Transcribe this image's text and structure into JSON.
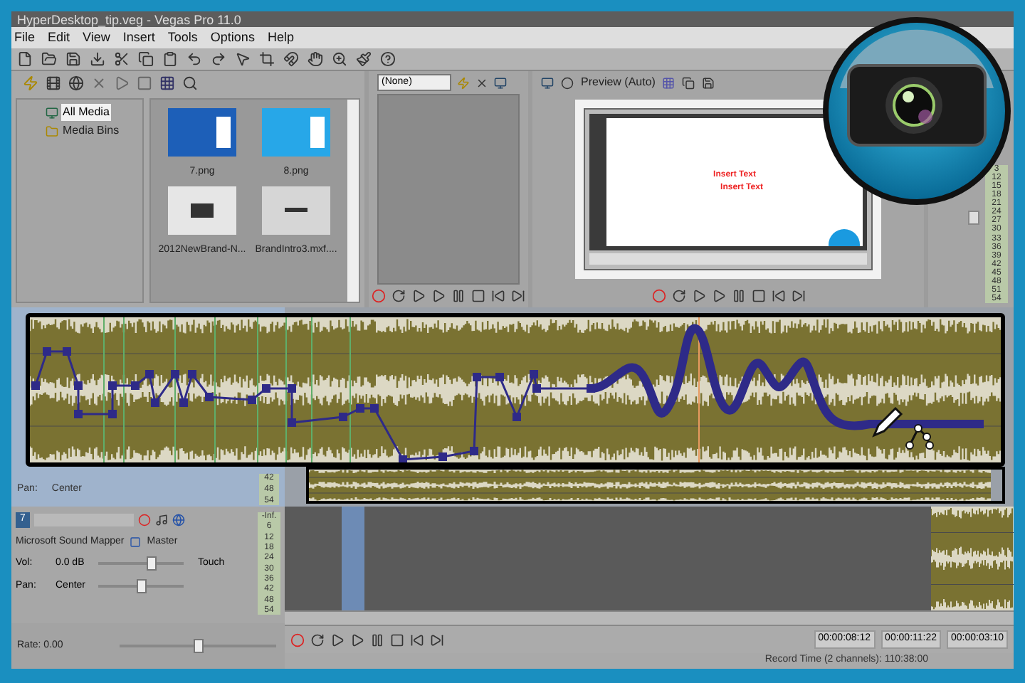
{
  "window": {
    "title": "HyperDesktop_tip.veg - Vegas Pro 11.0"
  },
  "menu": [
    "File",
    "Edit",
    "View",
    "Insert",
    "Tools",
    "Options",
    "Help"
  ],
  "explorer": {
    "tree": [
      {
        "label": "All Media",
        "selected": true
      },
      {
        "label": "Media Bins",
        "selected": false
      }
    ],
    "files": [
      {
        "name": "7.png",
        "kind": "desktop"
      },
      {
        "name": "8.png",
        "kind": "tile"
      },
      {
        "name": "2012NewBrand-N...",
        "kind": "slide"
      },
      {
        "name": "BrandIntro3.mxf....",
        "kind": "logo"
      }
    ]
  },
  "trimmer": {
    "source": "(None)"
  },
  "preview": {
    "mode": "Preview (Auto)",
    "frame_texts": [
      "Insert Text",
      "Insert Text"
    ]
  },
  "mixer": {
    "meter_ticks": [
      "3",
      "12",
      "15",
      "18",
      "21",
      "24",
      "27",
      "30",
      "33",
      "36",
      "39",
      "42",
      "45",
      "48",
      "51",
      "54"
    ]
  },
  "tracks": [
    {
      "pan": {
        "label": "Pan:",
        "value": "Center"
      },
      "meter_ticks": [
        "42",
        "48",
        "54"
      ]
    },
    {
      "number": "7",
      "device": "Microsoft Sound Mapper",
      "bus": "Master",
      "volume": {
        "label": "Vol:",
        "value": "0.0 dB",
        "level": 0.62
      },
      "pan": {
        "label": "Pan:",
        "value": "Center",
        "level": 0.5
      },
      "automation": "Touch",
      "meter_ticks": [
        "-Inf.",
        "6",
        "12",
        "18",
        "24",
        "30",
        "36",
        "42",
        "48",
        "54"
      ]
    }
  ],
  "rate": {
    "label": "Rate: 0.00",
    "level": 0.5
  },
  "transport": {
    "times": [
      "00:00:08:12",
      "00:00:11:22",
      "00:00:03:10"
    ]
  },
  "status_bar": "Record Time (2 channels): 110:38:00"
}
